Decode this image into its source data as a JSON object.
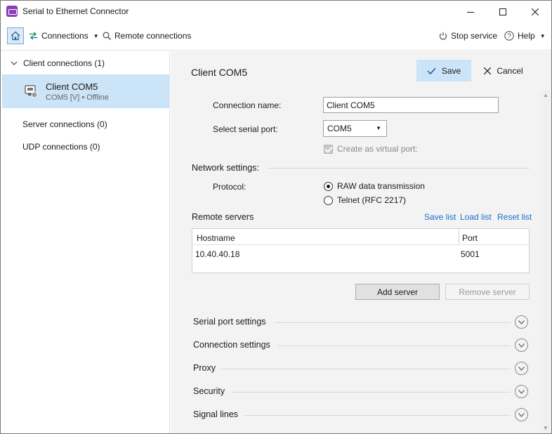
{
  "window": {
    "title": "Serial to Ethernet Connector",
    "accent": "#8a3fb8"
  },
  "toolbar": {
    "home_icon": "home-icon",
    "connections_label": "Connections",
    "remote_connections_label": "Remote connections",
    "stop_service_label": "Stop service",
    "help_label": "Help"
  },
  "sidebar": {
    "client_group_label": "Client connections (1)",
    "selected_item": {
      "name": "Client COM5",
      "status": "COM5 [V] • Offline"
    },
    "server_connections_label": "Server connections (0)",
    "udp_connections_label": "UDP connections (0)",
    "selection_color": "#cce4f7"
  },
  "main": {
    "title": "Client COM5",
    "save_label": "Save",
    "cancel_label": "Cancel",
    "connection_name_label": "Connection name:",
    "connection_name_value": "Client COM5",
    "serial_port_label": "Select serial port:",
    "serial_port_value": "COM5",
    "virtual_port_label": "Create as virtual port:",
    "network_settings_label": "Network settings:",
    "protocol_label": "Protocol:",
    "protocol_options": [
      "RAW data transmission",
      "Telnet (RFC 2217)"
    ],
    "protocol_selected": "RAW data transmission",
    "remote_servers_label": "Remote servers",
    "save_list_label": "Save list",
    "load_list_label": "Load list",
    "reset_list_label": "Reset list",
    "link_color": "#1a6fc9",
    "servers_table": {
      "columns": [
        "Hostname",
        "Port"
      ],
      "rows": [
        [
          "10.40.40.18",
          "5001"
        ]
      ]
    },
    "add_server_label": "Add server",
    "remove_server_label": "Remove server",
    "collapsible_sections": [
      "Serial port settings",
      "Connection settings",
      "Proxy",
      "Security",
      "Signal lines"
    ]
  }
}
